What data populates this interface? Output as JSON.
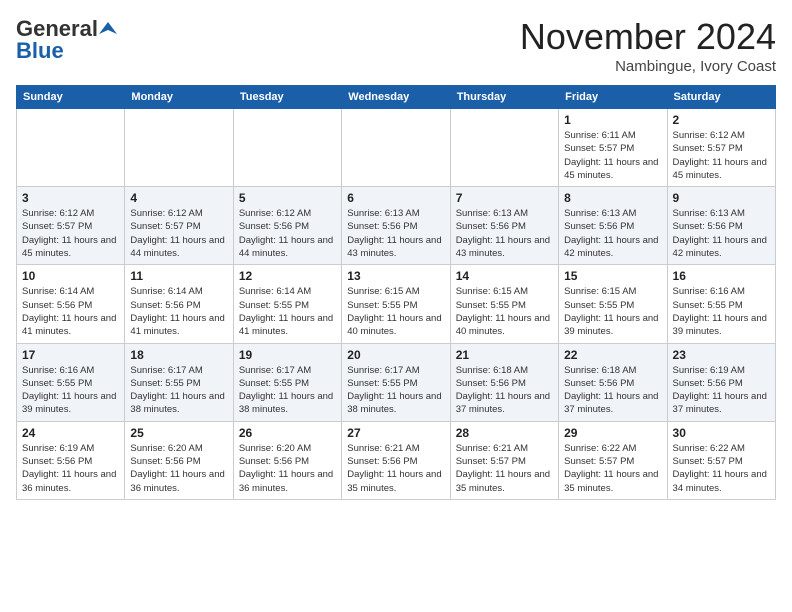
{
  "header": {
    "logo_general": "General",
    "logo_blue": "Blue",
    "month_title": "November 2024",
    "location": "Nambingue, Ivory Coast"
  },
  "calendar": {
    "days_of_week": [
      "Sunday",
      "Monday",
      "Tuesday",
      "Wednesday",
      "Thursday",
      "Friday",
      "Saturday"
    ],
    "weeks": [
      [
        {
          "day": "",
          "info": ""
        },
        {
          "day": "",
          "info": ""
        },
        {
          "day": "",
          "info": ""
        },
        {
          "day": "",
          "info": ""
        },
        {
          "day": "",
          "info": ""
        },
        {
          "day": "1",
          "info": "Sunrise: 6:11 AM\nSunset: 5:57 PM\nDaylight: 11 hours and 45 minutes."
        },
        {
          "day": "2",
          "info": "Sunrise: 6:12 AM\nSunset: 5:57 PM\nDaylight: 11 hours and 45 minutes."
        }
      ],
      [
        {
          "day": "3",
          "info": "Sunrise: 6:12 AM\nSunset: 5:57 PM\nDaylight: 11 hours and 45 minutes."
        },
        {
          "day": "4",
          "info": "Sunrise: 6:12 AM\nSunset: 5:57 PM\nDaylight: 11 hours and 44 minutes."
        },
        {
          "day": "5",
          "info": "Sunrise: 6:12 AM\nSunset: 5:56 PM\nDaylight: 11 hours and 44 minutes."
        },
        {
          "day": "6",
          "info": "Sunrise: 6:13 AM\nSunset: 5:56 PM\nDaylight: 11 hours and 43 minutes."
        },
        {
          "day": "7",
          "info": "Sunrise: 6:13 AM\nSunset: 5:56 PM\nDaylight: 11 hours and 43 minutes."
        },
        {
          "day": "8",
          "info": "Sunrise: 6:13 AM\nSunset: 5:56 PM\nDaylight: 11 hours and 42 minutes."
        },
        {
          "day": "9",
          "info": "Sunrise: 6:13 AM\nSunset: 5:56 PM\nDaylight: 11 hours and 42 minutes."
        }
      ],
      [
        {
          "day": "10",
          "info": "Sunrise: 6:14 AM\nSunset: 5:56 PM\nDaylight: 11 hours and 41 minutes."
        },
        {
          "day": "11",
          "info": "Sunrise: 6:14 AM\nSunset: 5:56 PM\nDaylight: 11 hours and 41 minutes."
        },
        {
          "day": "12",
          "info": "Sunrise: 6:14 AM\nSunset: 5:55 PM\nDaylight: 11 hours and 41 minutes."
        },
        {
          "day": "13",
          "info": "Sunrise: 6:15 AM\nSunset: 5:55 PM\nDaylight: 11 hours and 40 minutes."
        },
        {
          "day": "14",
          "info": "Sunrise: 6:15 AM\nSunset: 5:55 PM\nDaylight: 11 hours and 40 minutes."
        },
        {
          "day": "15",
          "info": "Sunrise: 6:15 AM\nSunset: 5:55 PM\nDaylight: 11 hours and 39 minutes."
        },
        {
          "day": "16",
          "info": "Sunrise: 6:16 AM\nSunset: 5:55 PM\nDaylight: 11 hours and 39 minutes."
        }
      ],
      [
        {
          "day": "17",
          "info": "Sunrise: 6:16 AM\nSunset: 5:55 PM\nDaylight: 11 hours and 39 minutes."
        },
        {
          "day": "18",
          "info": "Sunrise: 6:17 AM\nSunset: 5:55 PM\nDaylight: 11 hours and 38 minutes."
        },
        {
          "day": "19",
          "info": "Sunrise: 6:17 AM\nSunset: 5:55 PM\nDaylight: 11 hours and 38 minutes."
        },
        {
          "day": "20",
          "info": "Sunrise: 6:17 AM\nSunset: 5:55 PM\nDaylight: 11 hours and 38 minutes."
        },
        {
          "day": "21",
          "info": "Sunrise: 6:18 AM\nSunset: 5:56 PM\nDaylight: 11 hours and 37 minutes."
        },
        {
          "day": "22",
          "info": "Sunrise: 6:18 AM\nSunset: 5:56 PM\nDaylight: 11 hours and 37 minutes."
        },
        {
          "day": "23",
          "info": "Sunrise: 6:19 AM\nSunset: 5:56 PM\nDaylight: 11 hours and 37 minutes."
        }
      ],
      [
        {
          "day": "24",
          "info": "Sunrise: 6:19 AM\nSunset: 5:56 PM\nDaylight: 11 hours and 36 minutes."
        },
        {
          "day": "25",
          "info": "Sunrise: 6:20 AM\nSunset: 5:56 PM\nDaylight: 11 hours and 36 minutes."
        },
        {
          "day": "26",
          "info": "Sunrise: 6:20 AM\nSunset: 5:56 PM\nDaylight: 11 hours and 36 minutes."
        },
        {
          "day": "27",
          "info": "Sunrise: 6:21 AM\nSunset: 5:56 PM\nDaylight: 11 hours and 35 minutes."
        },
        {
          "day": "28",
          "info": "Sunrise: 6:21 AM\nSunset: 5:57 PM\nDaylight: 11 hours and 35 minutes."
        },
        {
          "day": "29",
          "info": "Sunrise: 6:22 AM\nSunset: 5:57 PM\nDaylight: 11 hours and 35 minutes."
        },
        {
          "day": "30",
          "info": "Sunrise: 6:22 AM\nSunset: 5:57 PM\nDaylight: 11 hours and 34 minutes."
        }
      ]
    ]
  }
}
